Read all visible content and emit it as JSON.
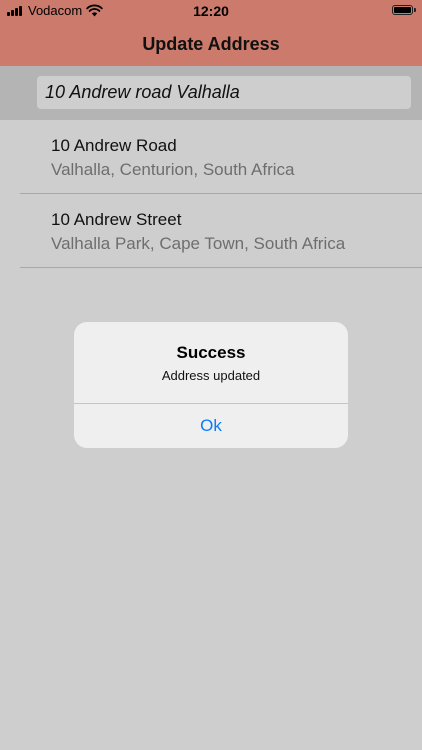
{
  "status_bar": {
    "carrier": "Vodacom",
    "time": "12:20",
    "battery_level": 1.0
  },
  "nav": {
    "title": "Update Address"
  },
  "search": {
    "value": "10 Andrew road Valhalla"
  },
  "results": [
    {
      "title": "10 Andrew Road",
      "subtitle": "Valhalla, Centurion, South Africa"
    },
    {
      "title": "10 Andrew Street",
      "subtitle": "Valhalla Park, Cape Town, South Africa"
    }
  ],
  "alert": {
    "title": "Success",
    "message": "Address updated",
    "button_label": "Ok"
  },
  "colors": {
    "header_bg": "#cb7a6b",
    "accent": "#0a7aff"
  }
}
